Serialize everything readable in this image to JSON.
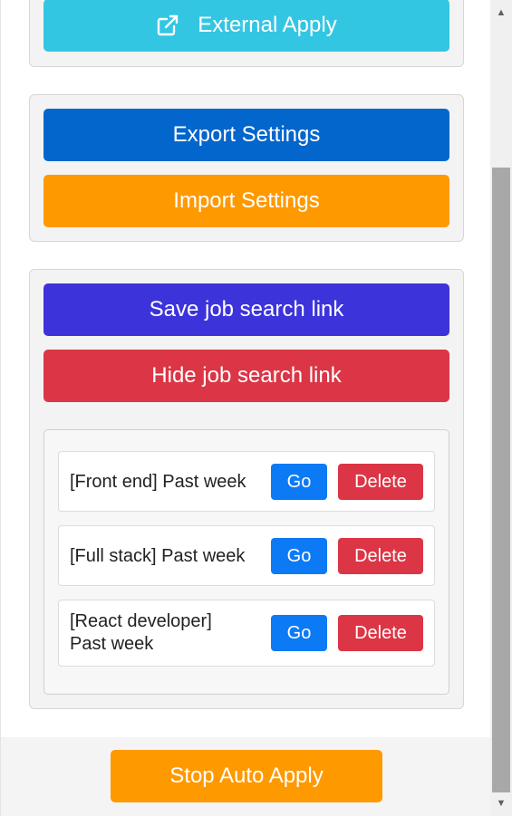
{
  "buttons": {
    "external_apply": "External Apply",
    "export_settings": "Export Settings",
    "import_settings": "Import Settings",
    "save_job_search_link": "Save job search link",
    "hide_job_search_link": "Hide job search link",
    "stop_auto_apply": "Stop Auto Apply"
  },
  "saved_links": [
    {
      "label": "[Front end] Past week",
      "go": "Go",
      "delete": "Delete"
    },
    {
      "label": "[Full stack] Past week",
      "go": "Go",
      "delete": "Delete"
    },
    {
      "label": "[React developer] Past week",
      "go": "Go",
      "delete": "Delete"
    }
  ],
  "icons": {
    "external_apply": "external-link-icon",
    "scroll_up": "chevron-up-icon",
    "scroll_down": "chevron-down-icon"
  },
  "colors": {
    "external_apply": "#33c6e3",
    "export_settings": "#0366cc",
    "import_settings": "#ff9900",
    "save_link": "#3d33db",
    "hide_link": "#dc3545",
    "go": "#0d7af5",
    "delete": "#dc3545",
    "stop_auto_apply": "#ff9900",
    "scroll_thumb": "#a8a8a8"
  }
}
